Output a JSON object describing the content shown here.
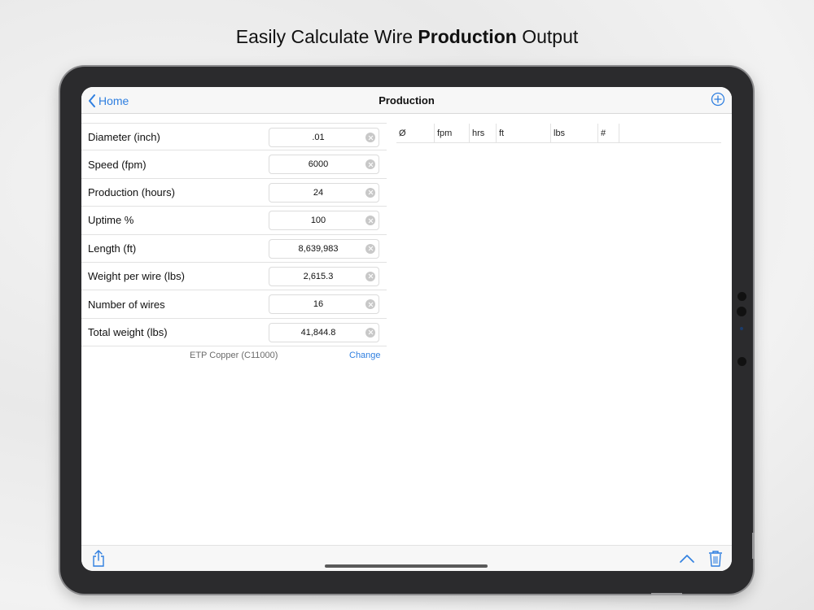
{
  "headline": {
    "prefix": "Easily Calculate Wire",
    "bold": "Production",
    "suffix": "Output"
  },
  "navbar": {
    "back_label": "Home",
    "title": "Production",
    "back_icon": "chevron-left-icon",
    "add_icon": "plus-circle-icon"
  },
  "form": {
    "rows": [
      {
        "label": "Diameter (inch)",
        "value": ".01"
      },
      {
        "label": "Speed (fpm)",
        "value": "6000"
      },
      {
        "label": "Production (hours)",
        "value": "24"
      },
      {
        "label": "Uptime %",
        "value": "100"
      },
      {
        "label": "Length (ft)",
        "value": "8,639,983"
      },
      {
        "label": "Weight per wire (lbs)",
        "value": "2,615.3"
      },
      {
        "label": "Number of wires",
        "value": "16"
      },
      {
        "label": "Total weight (lbs)",
        "value": "41,844.8"
      }
    ],
    "material": "ETP Copper (C11000)",
    "change_label": "Change"
  },
  "table": {
    "headers": [
      "Ø",
      "fpm",
      "hrs",
      "ft",
      "lbs",
      "#"
    ]
  },
  "toolbar": {
    "share_icon": "share-icon",
    "up_icon": "chevron-up-icon",
    "trash_icon": "trash-icon"
  },
  "colors": {
    "accent": "#2f7fe0",
    "device_bezel": "#2b2b2d"
  }
}
